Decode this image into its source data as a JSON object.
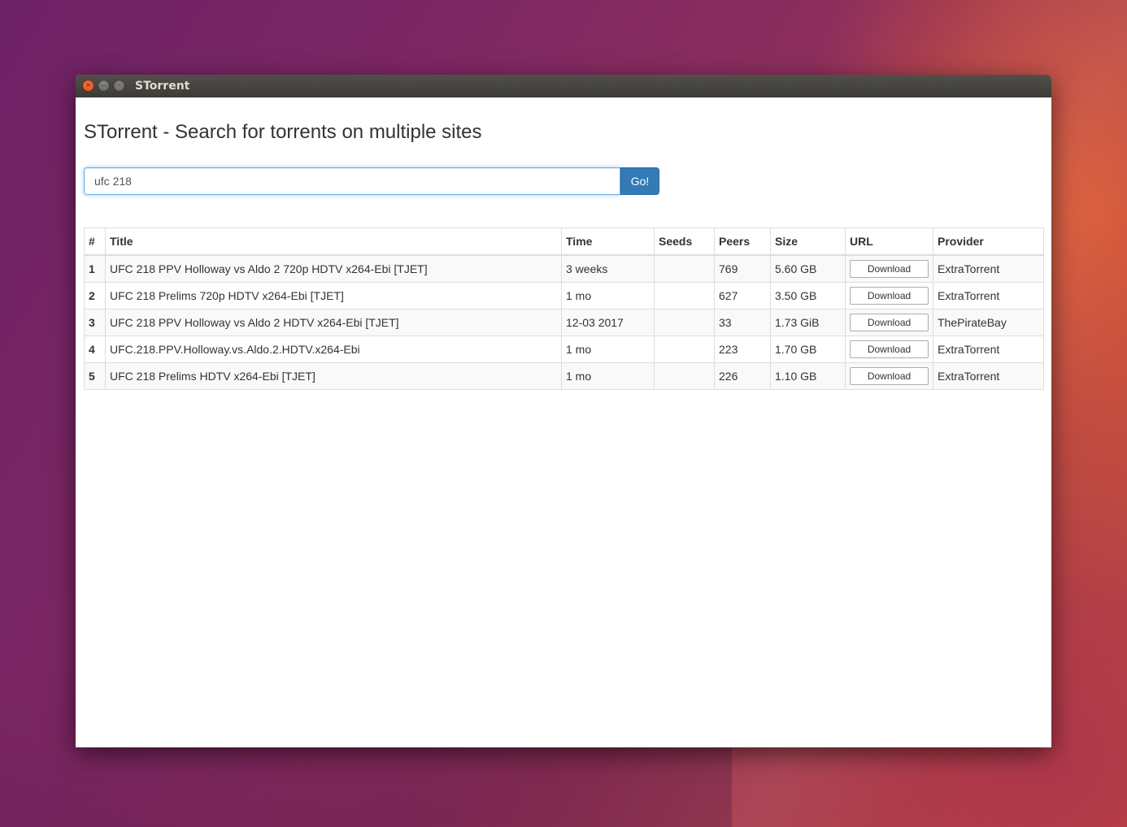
{
  "window": {
    "title": "STorrent"
  },
  "page": {
    "heading": "STorrent - Search for torrents on multiple sites"
  },
  "search": {
    "value": "ufc 218",
    "button_label": "Go!"
  },
  "table": {
    "headers": [
      "#",
      "Title",
      "Time",
      "Seeds",
      "Peers",
      "Size",
      "URL",
      "Provider"
    ],
    "rows": [
      {
        "num": "1",
        "title": "UFC 218 PPV Holloway vs Aldo 2 720p HDTV x264-Ebi [TJET]",
        "time": "3 weeks",
        "seeds": "",
        "peers": "769",
        "size": "5.60 GB",
        "url_label": "Download",
        "provider": "ExtraTorrent"
      },
      {
        "num": "2",
        "title": "UFC 218 Prelims 720p HDTV x264-Ebi [TJET]",
        "time": "1 mo",
        "seeds": "",
        "peers": "627",
        "size": "3.50 GB",
        "url_label": "Download",
        "provider": "ExtraTorrent"
      },
      {
        "num": "3",
        "title": "UFC 218 PPV Holloway vs Aldo 2 HDTV x264-Ebi [TJET]",
        "time": "12-03 2017",
        "seeds": "",
        "peers": "33",
        "size": "1.73 GiB",
        "url_label": "Download",
        "provider": "ThePirateBay"
      },
      {
        "num": "4",
        "title": "UFC.218.PPV.Holloway.vs.Aldo.2.HDTV.x264-Ebi",
        "time": "1 mo",
        "seeds": "",
        "peers": "223",
        "size": "1.70 GB",
        "url_label": "Download",
        "provider": "ExtraTorrent"
      },
      {
        "num": "5",
        "title": "UFC 218 Prelims HDTV x264-Ebi [TJET]",
        "time": "1 mo",
        "seeds": "",
        "peers": "226",
        "size": "1.10 GB",
        "url_label": "Download",
        "provider": "ExtraTorrent"
      }
    ]
  },
  "icons": {
    "close": "close-icon",
    "minimize": "minimize-icon",
    "maximize": "maximize-icon"
  },
  "colors": {
    "accent": "#337ab7",
    "close_button": "#df4a16",
    "titlebar": "#3c3b37"
  }
}
